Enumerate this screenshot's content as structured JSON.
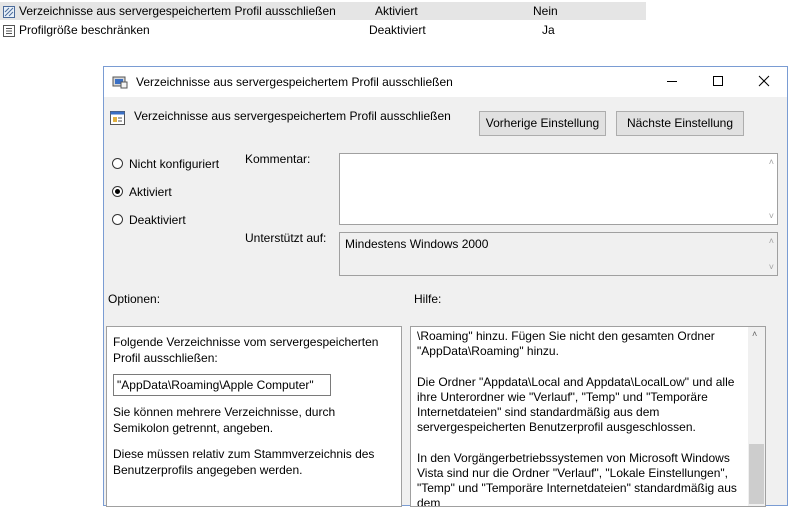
{
  "policy_list": {
    "rows": [
      {
        "name": "Verzeichnisse aus servergespeichertem Profil ausschließen",
        "state": "Aktiviert",
        "comment": "Nein"
      },
      {
        "name": "Profilgröße beschränken",
        "state": "Deaktiviert",
        "comment": "Ja"
      }
    ]
  },
  "dialog": {
    "title": "Verzeichnisse aus servergespeichertem Profil ausschließen",
    "header": "Verzeichnisse aus servergespeichertem Profil ausschließen",
    "prev_button": "Vorherige Einstellung",
    "next_button": "Nächste Einstellung",
    "radios": [
      {
        "label": "Nicht konfiguriert",
        "checked": false
      },
      {
        "label": "Aktiviert",
        "checked": true
      },
      {
        "label": "Deaktiviert",
        "checked": false
      }
    ],
    "comment_label": "Kommentar:",
    "comment_value": "",
    "supported_label": "Unterstützt auf:",
    "supported_value": "Mindestens Windows 2000",
    "options_label": "Optionen:",
    "help_label": "Hilfe:",
    "options": {
      "intro": "Folgende Verzeichnisse vom servergespeicherten Profil ausschließen:",
      "input_value": "\"AppData\\Roaming\\Apple Computer\"",
      "note1": "Sie können mehrere Verzeichnisse, durch Semikolon getrennt, angeben.",
      "note2": "Diese müssen relativ zum Stammverzeichnis des Benutzerprofils angegeben werden."
    },
    "help": {
      "p1": "\\Roaming\" hinzu. Fügen Sie nicht den gesamten Ordner \"AppData\\Roaming\" hinzu.",
      "p2": "Die Ordner \"Appdata\\Local and Appdata\\LocalLow\" und alle ihre Unterordner wie \"Verlauf\", \"Temp\" und \"Temporäre Internetdateien\" sind standardmäßig aus dem servergespeicherten Benutzerprofil ausgeschlossen.",
      "p3": "In den Vorgängerbetriebssystemen von Microsoft Windows Vista sind nur die Ordner \"Verlauf\", \"Lokale Einstellungen\", \"Temp\" und \"Temporäre Internetdateien\" standardmäßig aus dem"
    }
  }
}
